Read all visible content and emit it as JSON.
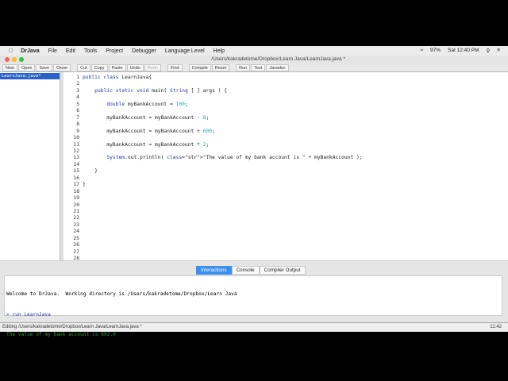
{
  "menubar": {
    "app": "DrJava",
    "items": [
      "File",
      "Edit",
      "Tools",
      "Project",
      "Debugger",
      "Language Level",
      "Help"
    ],
    "battery": "97%",
    "clock": "Sat 12:40 PM"
  },
  "window": {
    "title": "/Users/kakradetome/Dropbox/Learn Java/LearnJava.java *"
  },
  "toolbar": [
    "New",
    "Open",
    "Save",
    "Close",
    "Cut",
    "Copy",
    "Paste",
    "Undo",
    "Redo",
    "Find",
    "Compile",
    "Reset",
    "Run",
    "Test",
    "Javadoc"
  ],
  "files": {
    "selected": "LearnJava.java*"
  },
  "editor": {
    "lines": [
      "public class LearnJava{",
      "",
      "    public static void main( String [ ] args ) {",
      "",
      "        double myBankAccount = 100;",
      "",
      "        myBankAccount = myBankAccount - 8;",
      "",
      "        myBankAccount = myBankAccount + 600;",
      "",
      "        myBankAccount = myBankAccount * 2;",
      "",
      "        System.out.println( \"The value of my bank account is \" + myBankAccount );",
      "",
      "    }",
      "",
      "}",
      "",
      "",
      "",
      "",
      "",
      "",
      "",
      "",
      "",
      "",
      ""
    ]
  },
  "tabs": [
    "Interactions",
    "Console",
    "Compiler Output"
  ],
  "interactions": {
    "welcome": "Welcome to DrJava.  Working directory is /Users/kakradetome/Dropbox/Learn Java",
    "command": "> run LearnJava",
    "output": "The value of my bank account is 692.0",
    "prompt": ">"
  },
  "status": {
    "text": "Editing /Users/kakradetome/Dropbox/Learn Java/LearnJava.java *",
    "position": "11:42"
  }
}
